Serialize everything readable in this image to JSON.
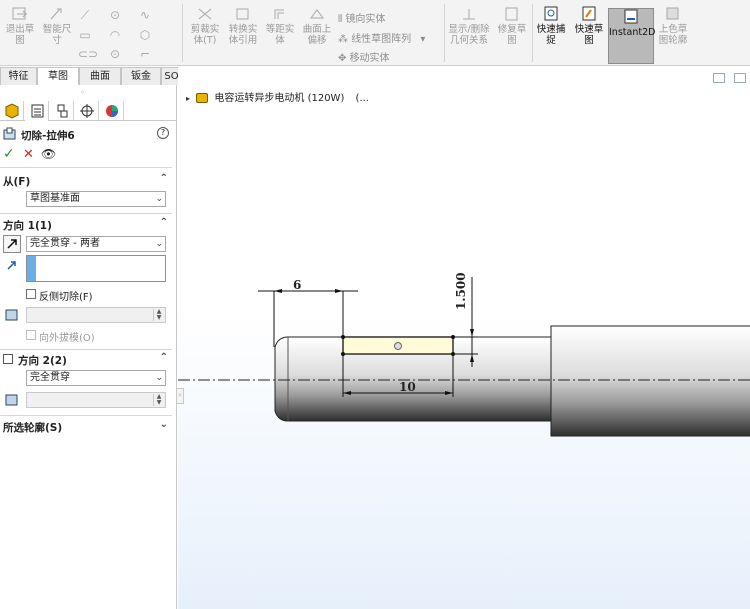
{
  "ribbon": {
    "exit_sketch": "退出草\n图",
    "smart_dim": "智能尺\n寸",
    "trim": "剪裁实\n体(T)",
    "convert": "转换实\n体引用",
    "offset": "等距实\n体",
    "surface_offset": "曲面上\n偏移",
    "mirror": "镜向实体",
    "linear_pattern": "线性草图阵列",
    "move": "移动实体",
    "relations": "显示/删除\n几何关系",
    "repair": "修复草\n图",
    "quick_snap": "快速捕\n捉",
    "rapid_sketch": "快速草\n图",
    "instant2d": "Instant2D",
    "shaded_contours": "上色草\n图轮廓"
  },
  "tabs": [
    "特征",
    "草图",
    "曲面",
    "钣金",
    "SOLIDWORKS 插件"
  ],
  "active_tab": "草图",
  "panel": {
    "title": "切除-拉伸6",
    "help": "?",
    "ok": "✓",
    "cancel": "✕",
    "preview": "👁",
    "from_label": "从(F)",
    "from_value": "草图基准面",
    "dir1_label": "方向 1(1)",
    "dir1_value": "完全贯穿 - 两者",
    "flip_side": "反侧切除(F)",
    "draft_outward": "向外拔模(O)",
    "dir2_label": "方向 2(2)",
    "dir2_value": "完全贯穿",
    "contours_label": "所选轮廓(S)"
  },
  "tree": {
    "part_name": "电容运转异步电动机 (120W)",
    "ellipsis": "(..."
  },
  "drawing": {
    "dim_width": "6",
    "dim_height": "1.500",
    "dim_length": "10"
  }
}
